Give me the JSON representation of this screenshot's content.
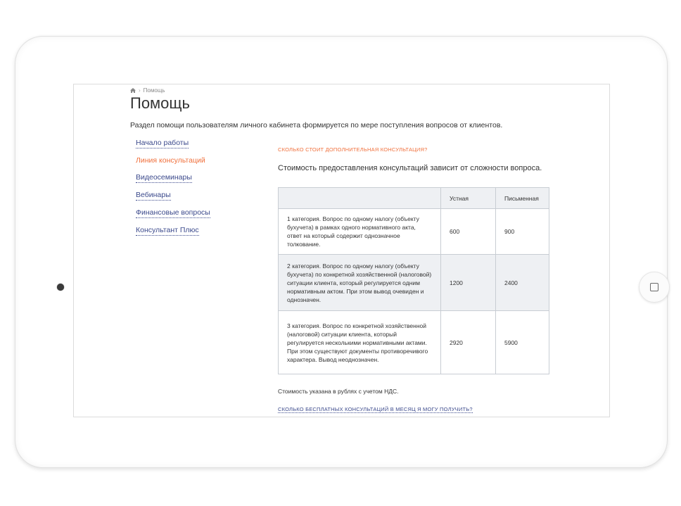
{
  "breadcrumb": {
    "icon": "home-icon",
    "current": "Помощь",
    "separator": "›"
  },
  "page": {
    "title": "Помощь",
    "intro": "Раздел помощи пользователям личного кабинета формируется по мере поступления вопросов от клиентов."
  },
  "sidebar": {
    "items": [
      {
        "label": "Начало работы",
        "active": false
      },
      {
        "label": "Линия консультаций",
        "active": true
      },
      {
        "label": "Видеосеминары",
        "active": false
      },
      {
        "label": "Вебинары",
        "active": false
      },
      {
        "label": "Финансовые вопросы",
        "active": false
      },
      {
        "label": "Консультант Плюс",
        "active": false
      }
    ]
  },
  "content": {
    "question": "Сколько стоит дополнительная консультация?",
    "answer": "Стоимость предоставления консультаций зависит от сложности вопроса.",
    "table": {
      "headers": [
        "",
        "Устная",
        "Письменная"
      ],
      "rows": [
        {
          "category": "1 категория. Вопрос по одному налогу (объекту бухучета) в рамках одного нормативного акта, ответ на который содержит однозначное толкование.",
          "oral": "600",
          "written": "900"
        },
        {
          "category": "2 категория. Вопрос по одному налогу (объекту бухучета) по конкретной хозяйственной (налоговой) ситуации клиента, который регулируется одним нормативным актом. При этом вывод очевиден и однозначен.",
          "oral": "1200",
          "written": "2400"
        },
        {
          "category": "3 категория. Вопрос по конкретной хозяйственной (налоговой) ситуации клиента, который регулируется несколькими нормативными актами. При этом существуют документы противоречивого характера. Вывод неоднозначен.",
          "oral": "2920",
          "written": "5900"
        }
      ]
    },
    "note": "Стоимость указана в рублях с учетом НДС.",
    "next_question": "Сколько бесплатных консультаций в месяц я могу получить?"
  },
  "colors": {
    "accent": "#f0703c",
    "link": "#3c4a8c",
    "table_shade": "#eef0f3",
    "border": "#c8cdd3"
  }
}
